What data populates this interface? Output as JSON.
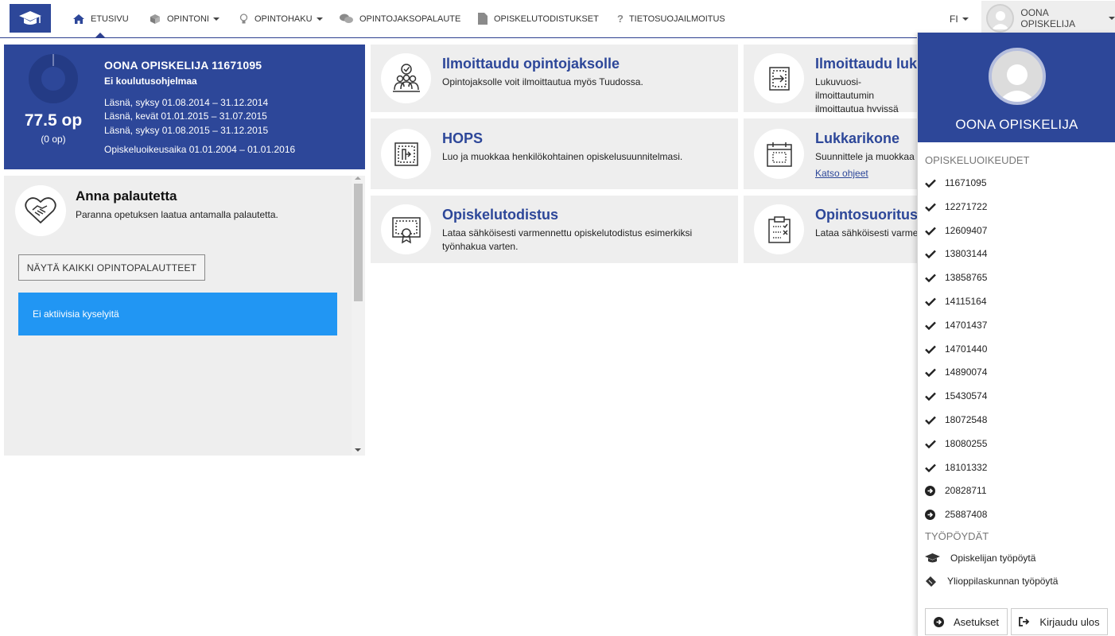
{
  "nav": {
    "items": [
      {
        "label": "ETUSIVU",
        "icon": "home-icon"
      },
      {
        "label": "OPINTONI",
        "icon": "box-icon",
        "dropdown": true
      },
      {
        "label": "OPINTOHAKU",
        "icon": "lightbulb-icon",
        "dropdown": true
      },
      {
        "label": "OPINTOJAKSOPALAUTE",
        "icon": "comments-icon"
      },
      {
        "label": "OPISKELUTODISTUKSET",
        "icon": "document-icon"
      },
      {
        "label": "TIETOSUOJAILMOITUS",
        "icon": "question-icon"
      }
    ],
    "language": "FI",
    "user": "OONA OPISKELIJA"
  },
  "profile": {
    "name": "OONA OPISKELIJA 11671095",
    "program": "Ei koulutusohjelmaa",
    "terms": [
      "Läsnä, syksy 01.08.2014 – 31.12.2014",
      "Läsnä, kevät 01.01.2015 – 31.07.2015",
      "Läsnä, syksy 01.08.2015 – 31.12.2015"
    ],
    "right_period": "Opiskeluoikeusaika 01.01.2004 – 01.01.2016",
    "credits": "77.5 op",
    "credits_sub": "(0 op)"
  },
  "feedback": {
    "title": "Anna palautetta",
    "subtitle": "Paranna opetuksen laatua antamalla palautetta.",
    "button": "NÄYTÄ KAIKKI OPINTOPALAUTTEET",
    "alert": "Ei aktiivisia kyselyitä"
  },
  "tiles": [
    {
      "title": "Ilmoittaudu opintojaksolle",
      "desc": "Opintojaksolle voit ilmoittautua myös Tuudossa.",
      "icon": "group-check-icon"
    },
    {
      "title": "Ilmoittaudu luk",
      "desc": "Lukuvuosi-ilmoittautumin ilmoittautua hyvissä ajoin",
      "icon": "sign-in-frame-icon"
    },
    {
      "title": "HOPS",
      "desc": "Luo ja muokkaa henkilökohtainen opiskelusuunnitelmasi.",
      "icon": "plan-icon"
    },
    {
      "title": "Lukkarikone",
      "desc": "Suunnittele ja muokkaa l",
      "link": "Katso ohjeet",
      "icon": "calendar-icon"
    },
    {
      "title": "Opiskelutodistus",
      "desc": "Lataa sähköisesti varmennettu opiskelutodistus esimerkiksi työnhakua varten.",
      "icon": "certificate-icon"
    },
    {
      "title": "Opintosuoritus",
      "desc": "Lataa sähköisesti varmer",
      "icon": "clipboard-checklist-icon"
    }
  ],
  "dropdown": {
    "name": "OONA OPISKELIJA",
    "rights_header": "OPISKELUOIKEUDET",
    "rights": [
      {
        "id": "11671095",
        "mark": "check"
      },
      {
        "id": "12271722",
        "mark": "check"
      },
      {
        "id": "12609407",
        "mark": "check"
      },
      {
        "id": "13803144",
        "mark": "check"
      },
      {
        "id": "13858765",
        "mark": "check"
      },
      {
        "id": "14115164",
        "mark": "check"
      },
      {
        "id": "14701437",
        "mark": "check"
      },
      {
        "id": "14701440",
        "mark": "check"
      },
      {
        "id": "14890074",
        "mark": "check"
      },
      {
        "id": "15430574",
        "mark": "check"
      },
      {
        "id": "18072548",
        "mark": "check"
      },
      {
        "id": "18080255",
        "mark": "check"
      },
      {
        "id": "18101332",
        "mark": "check"
      },
      {
        "id": "20828711",
        "mark": "arrow"
      },
      {
        "id": "25887408",
        "mark": "arrow"
      }
    ],
    "desktops_header": "TYÖPÖYDÄT",
    "desktops": [
      {
        "label": "Opiskelijan työpöytä",
        "icon": "graduation-cap-icon"
      },
      {
        "label": "Ylioppilaskunnan työpöytä",
        "icon": "ticket-icon"
      }
    ],
    "settings": "Asetukset",
    "logout": "Kirjaudu ulos"
  },
  "colors": {
    "primary": "#2d4799",
    "alert": "#2196f3",
    "tile_bg": "#eeeeee"
  }
}
